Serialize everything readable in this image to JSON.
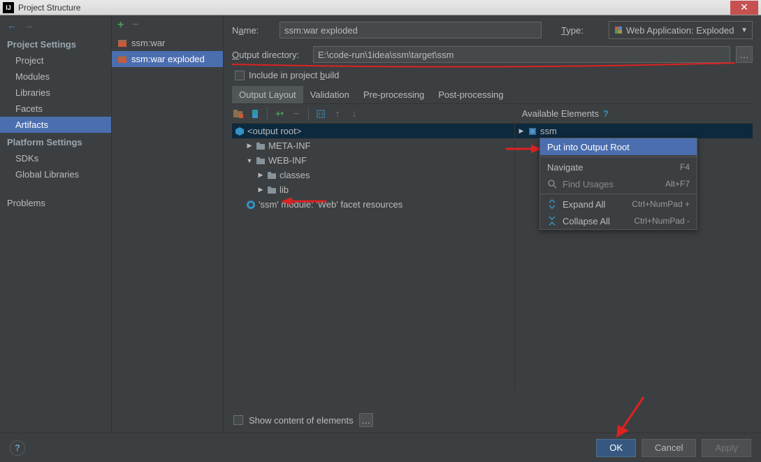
{
  "window": {
    "title": "Project Structure"
  },
  "sidebar": {
    "heading1": "Project Settings",
    "items1": [
      "Project",
      "Modules",
      "Libraries",
      "Facets",
      "Artifacts"
    ],
    "heading2": "Platform Settings",
    "items2": [
      "SDKs",
      "Global Libraries"
    ],
    "extra": "Problems"
  },
  "artifacts": {
    "items": [
      {
        "label": "ssm:war"
      },
      {
        "label": "ssm:war exploded"
      }
    ]
  },
  "form": {
    "name_label": "Name:",
    "name_value": "ssm:war exploded",
    "type_label": "Type:",
    "type_value": "Web Application: Exploded",
    "outdir_label": "Output directory:",
    "outdir_value": "E:\\code-run\\1idea\\ssm\\target\\ssm",
    "include_label": "Include in project build"
  },
  "tabs": [
    "Output Layout",
    "Validation",
    "Pre-processing",
    "Post-processing"
  ],
  "avail_label": "Available Elements",
  "tree": {
    "root": "<output root>",
    "meta": "META-INF",
    "web": "WEB-INF",
    "classes": "classes",
    "lib": "lib",
    "facet": "'ssm' module: 'Web' facet resources"
  },
  "avail_tree": {
    "ssm": "ssm"
  },
  "ctx": {
    "put": "Put into Output Root",
    "nav": "Navigate",
    "nav_sc": "F4",
    "find": "Find Usages",
    "find_sc": "Alt+F7",
    "expand": "Expand All",
    "expand_sc": "Ctrl+NumPad +",
    "collapse": "Collapse All",
    "collapse_sc": "Ctrl+NumPad -"
  },
  "footer": {
    "show_content": "Show content of elements",
    "ok": "OK",
    "cancel": "Cancel",
    "apply": "Apply"
  }
}
